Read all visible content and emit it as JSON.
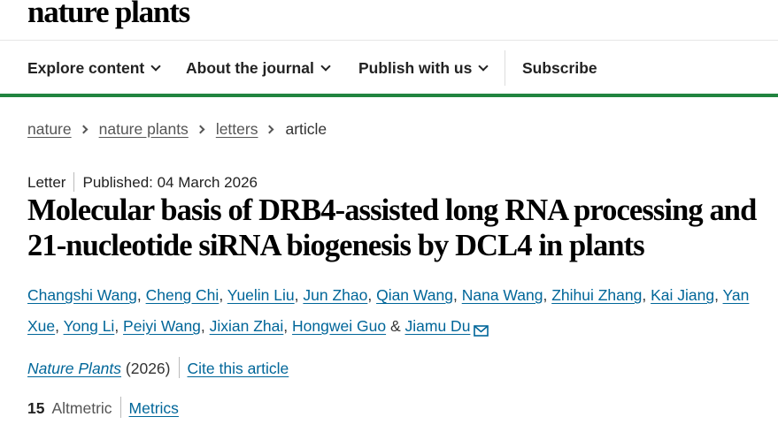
{
  "site": {
    "brand": "nature plants"
  },
  "nav": {
    "explore": "Explore content",
    "about": "About the journal",
    "publish": "Publish with us",
    "subscribe": "Subscribe"
  },
  "breadcrumb": [
    "nature",
    "nature plants",
    "letters",
    "article"
  ],
  "article": {
    "type": "Letter",
    "published": "Published: 04 March 2026",
    "title": "Molecular basis of DRB4-assisted long RNA processing and 21-nucleotide siRNA biogenesis by DCL4 in plants",
    "authors": [
      "Changshi Wang",
      "Cheng Chi",
      "Yuelin Liu",
      "Jun Zhao",
      "Qian Wang",
      "Nana Wang",
      "Zhihui Zhang",
      "Kai Jiang",
      "Yan Xue",
      "Yong Li",
      "Peiyi Wang",
      "Jixian Zhai",
      "Hongwei Guo",
      "Jiamu Du"
    ],
    "authors_conjunction": "&",
    "journal": "Nature Plants",
    "year": "(2026)",
    "cite": "Cite this article",
    "altmetric_score": "15",
    "altmetric_label": "Altmetric",
    "metrics_link": "Metrics"
  },
  "colors": {
    "accent_green": "#21843f",
    "link_blue": "#006699"
  },
  "icons": {
    "nav_dropdown": "chevron-down-icon",
    "breadcrumb_separator": "chevron-right-icon",
    "corresponding_author": "mail-icon"
  }
}
